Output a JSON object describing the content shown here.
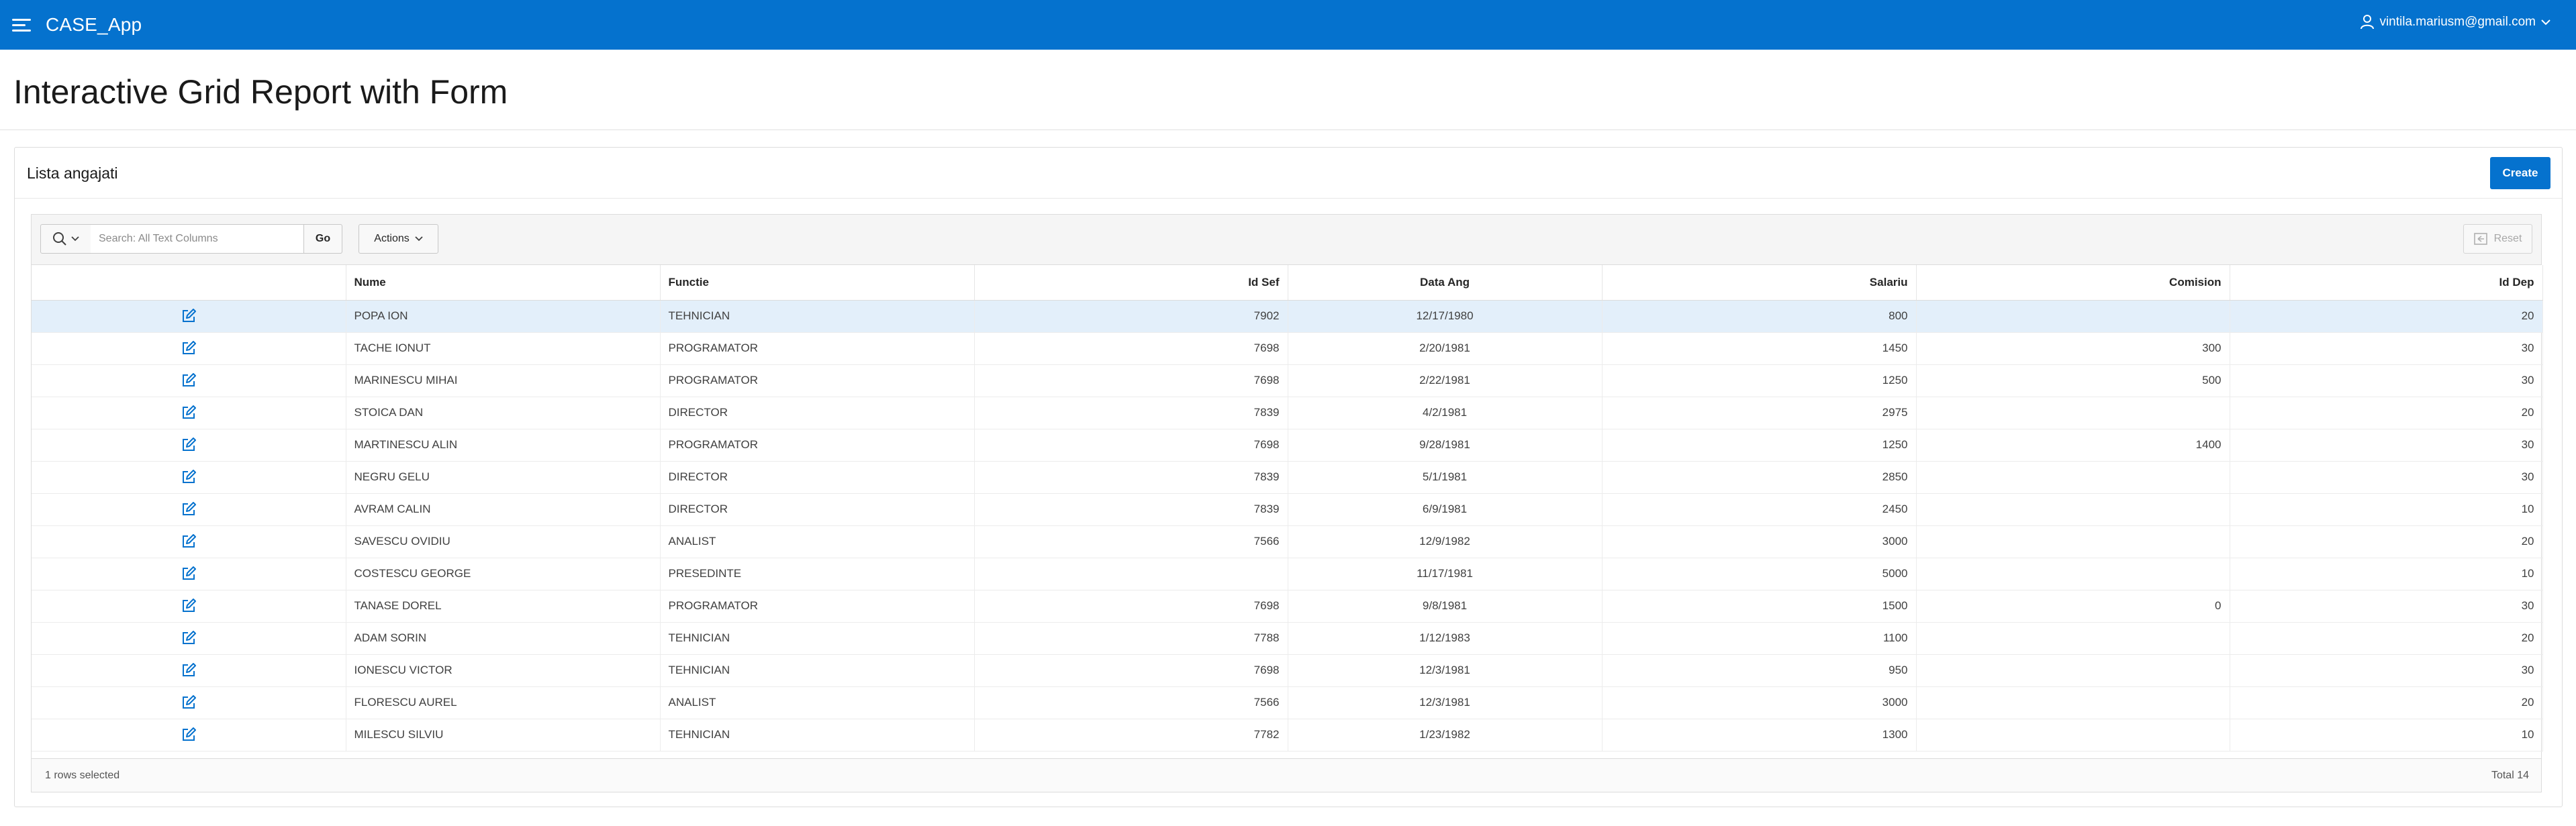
{
  "header": {
    "app_title": "CASE_App",
    "user": "vintila.mariusm@gmail.com"
  },
  "page": {
    "title": "Interactive Grid Report with Form"
  },
  "region": {
    "title": "Lista angajati",
    "create_label": "Create"
  },
  "toolbar": {
    "search_placeholder": "Search: All Text Columns",
    "go_label": "Go",
    "actions_label": "Actions",
    "reset_label": "Reset"
  },
  "grid": {
    "columns": [
      "",
      "Nume",
      "Functie",
      "Id Sef",
      "Data Ang",
      "Salariu",
      "Comision",
      "Id Dep"
    ],
    "rows": [
      [
        "POPA ION",
        "TEHNICIAN",
        "7902",
        "12/17/1980",
        "800",
        "",
        "20"
      ],
      [
        "TACHE IONUT",
        "PROGRAMATOR",
        "7698",
        "2/20/1981",
        "1450",
        "300",
        "30"
      ],
      [
        "MARINESCU MIHAI",
        "PROGRAMATOR",
        "7698",
        "2/22/1981",
        "1250",
        "500",
        "30"
      ],
      [
        "STOICA DAN",
        "DIRECTOR",
        "7839",
        "4/2/1981",
        "2975",
        "",
        "20"
      ],
      [
        "MARTINESCU ALIN",
        "PROGRAMATOR",
        "7698",
        "9/28/1981",
        "1250",
        "1400",
        "30"
      ],
      [
        "NEGRU GELU",
        "DIRECTOR",
        "7839",
        "5/1/1981",
        "2850",
        "",
        "30"
      ],
      [
        "AVRAM CALIN",
        "DIRECTOR",
        "7839",
        "6/9/1981",
        "2450",
        "",
        "10"
      ],
      [
        "SAVESCU OVIDIU",
        "ANALIST",
        "7566",
        "12/9/1982",
        "3000",
        "",
        "20"
      ],
      [
        "COSTESCU GEORGE",
        "PRESEDINTE",
        "",
        "11/17/1981",
        "5000",
        "",
        "10"
      ],
      [
        "TANASE DOREL",
        "PROGRAMATOR",
        "7698",
        "9/8/1981",
        "1500",
        "0",
        "30"
      ],
      [
        "ADAM SORIN",
        "TEHNICIAN",
        "7788",
        "1/12/1983",
        "1100",
        "",
        "20"
      ],
      [
        "IONESCU VICTOR",
        "TEHNICIAN",
        "7698",
        "12/3/1981",
        "950",
        "",
        "30"
      ],
      [
        "FLORESCU AUREL",
        "ANALIST",
        "7566",
        "12/3/1981",
        "3000",
        "",
        "20"
      ],
      [
        "MILESCU SILVIU",
        "TEHNICIAN",
        "7782",
        "1/23/1982",
        "1300",
        "",
        "10"
      ]
    ],
    "selected_row": 0
  },
  "footer": {
    "selection_text": "1 rows selected",
    "total_text": "Total 14"
  },
  "colors": {
    "brand": "#0572ce",
    "selected_row": "#e3effa"
  }
}
